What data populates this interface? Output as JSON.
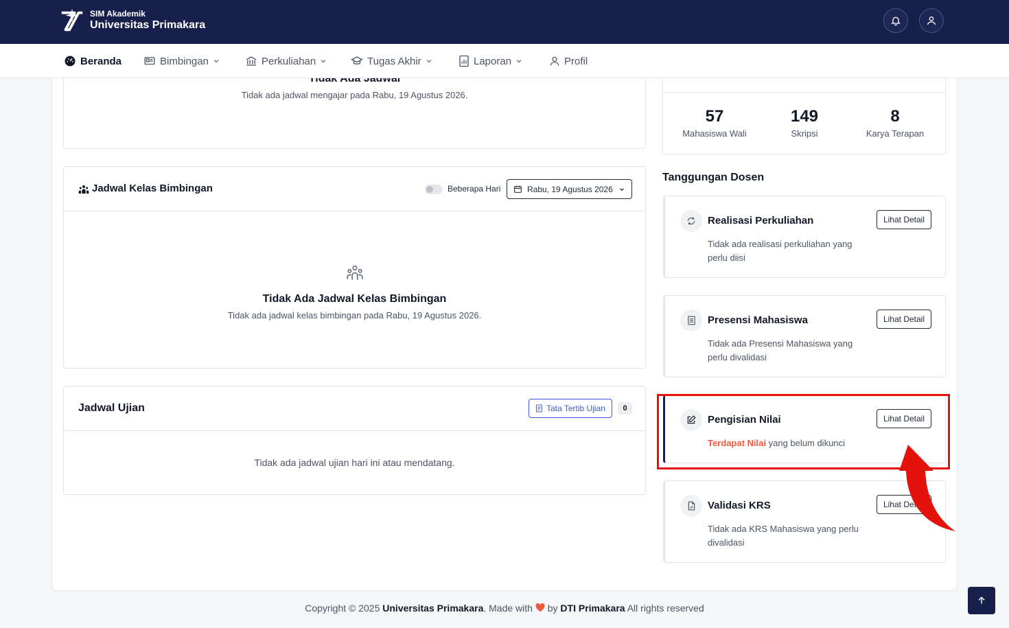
{
  "app": {
    "subtitle": "SIM Akademik",
    "title": "Universitas Primakara"
  },
  "nav": {
    "items": [
      {
        "label": "Beranda",
        "icon": "dashboard-icon"
      },
      {
        "label": "Bimbingan",
        "icon": "presentation-icon"
      },
      {
        "label": "Perkuliahan",
        "icon": "building-icon"
      },
      {
        "label": "Tugas Akhir",
        "icon": "graduation-cap-icon"
      },
      {
        "label": "Laporan",
        "icon": "report-icon"
      },
      {
        "label": "Profil",
        "icon": "user-icon"
      }
    ]
  },
  "jadwal_mengajar": {
    "title": "Tidak Ada Jadwal",
    "message": "Tidak ada jadwal mengajar pada Rabu, 19 Agustus 2026."
  },
  "jadwal_bimbingan": {
    "title": "Jadwal Kelas Bimbingan",
    "toggle_label": "Beberapa Hari",
    "date": "Rabu, 19 Agustus 2026",
    "empty_title": "Tidak Ada Jadwal Kelas Bimbingan",
    "empty_message": "Tidak ada jadwal kelas bimbingan pada Rabu, 19 Agustus 2026."
  },
  "jadwal_ujian": {
    "title": "Jadwal Ujian",
    "button_label": "Tata Tertib Ujian",
    "count": "0",
    "empty_message": "Tidak ada jadwal ujian hari ini atau mendatang."
  },
  "stats": [
    {
      "value": "57",
      "label": "Mahasiswa Wali"
    },
    {
      "value": "149",
      "label": "Skripsi"
    },
    {
      "value": "8",
      "label": "Karya Terapan"
    }
  ],
  "tanggungan": {
    "heading": "Tanggungan Dosen",
    "button_label": "Lihat Detail",
    "tasks": [
      {
        "title": "Realisasi Perkuliahan",
        "desc": "Tidak ada realisasi perkuliahan yang perlu diisi",
        "icon": "refresh-icon"
      },
      {
        "title": "Presensi Mahasiswa",
        "desc": "Tidak ada Presensi Mahasiswa yang perlu divalidasi",
        "icon": "document-list-icon"
      },
      {
        "title": "Pengisian Nilai",
        "desc_highlight": "Terdapat Nilai",
        "desc_rest": " yang belum dikunci",
        "icon": "edit-icon"
      },
      {
        "title": "Validasi KRS",
        "desc": "Tidak ada KRS Mahasiswa yang perlu divalidasi",
        "icon": "file-check-icon"
      }
    ]
  },
  "footer": {
    "copyright": "Copyright © 2025 ",
    "org": "Universitas Primakara",
    "made_with": ". Made with ",
    "by": " by ",
    "team": "DTI Primakara",
    "rights": " All rights reserved"
  },
  "colors": {
    "navy": "#16204b",
    "accent_red": "#e3120b",
    "alert_text": "#ef5a3c",
    "link_blue": "#3b5bdb"
  }
}
